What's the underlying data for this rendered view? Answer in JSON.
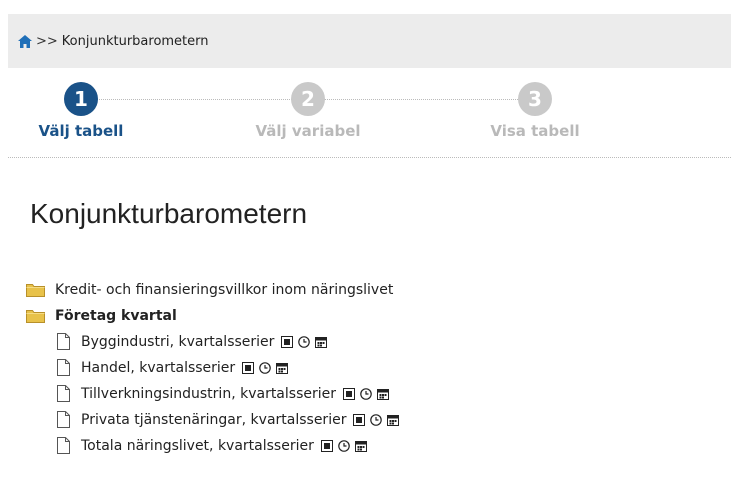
{
  "breadcrumb": {
    "home_icon": "home-icon",
    "separator": ">>",
    "current": "Konjunkturbarometern"
  },
  "steps": [
    {
      "number": "1",
      "label": "Välj tabell",
      "state": "active"
    },
    {
      "number": "2",
      "label": "Välj variabel",
      "state": "inactive"
    },
    {
      "number": "3",
      "label": "Visa tabell",
      "state": "inactive"
    }
  ],
  "page": {
    "title": "Konjunkturbarometern"
  },
  "tree": {
    "folders": [
      {
        "label": "Kredit- och finansieringsvillkor inom näringslivet",
        "icon": "folder-icon",
        "expanded": false
      },
      {
        "label": "Företag kvartal",
        "icon": "folder-icon",
        "expanded": true
      }
    ],
    "tables": [
      {
        "label": "Byggindustri, kvartalsserier"
      },
      {
        "label": "Handel, kvartalsserier"
      },
      {
        "label": "Tillverkningsindustrin, kvartalsserier"
      },
      {
        "label": "Privata tjänstenäringar, kvartalsserier"
      },
      {
        "label": "Totala näringslivet, kvartalsserier"
      }
    ],
    "table_action_icons": [
      "table-info-icon",
      "clock-icon",
      "calendar-icon"
    ]
  },
  "colors": {
    "active_step": "#1a5288",
    "inactive_step": "#c9c9c9",
    "breadcrumb_bg": "#ececec",
    "folder": "#e8c24a"
  }
}
